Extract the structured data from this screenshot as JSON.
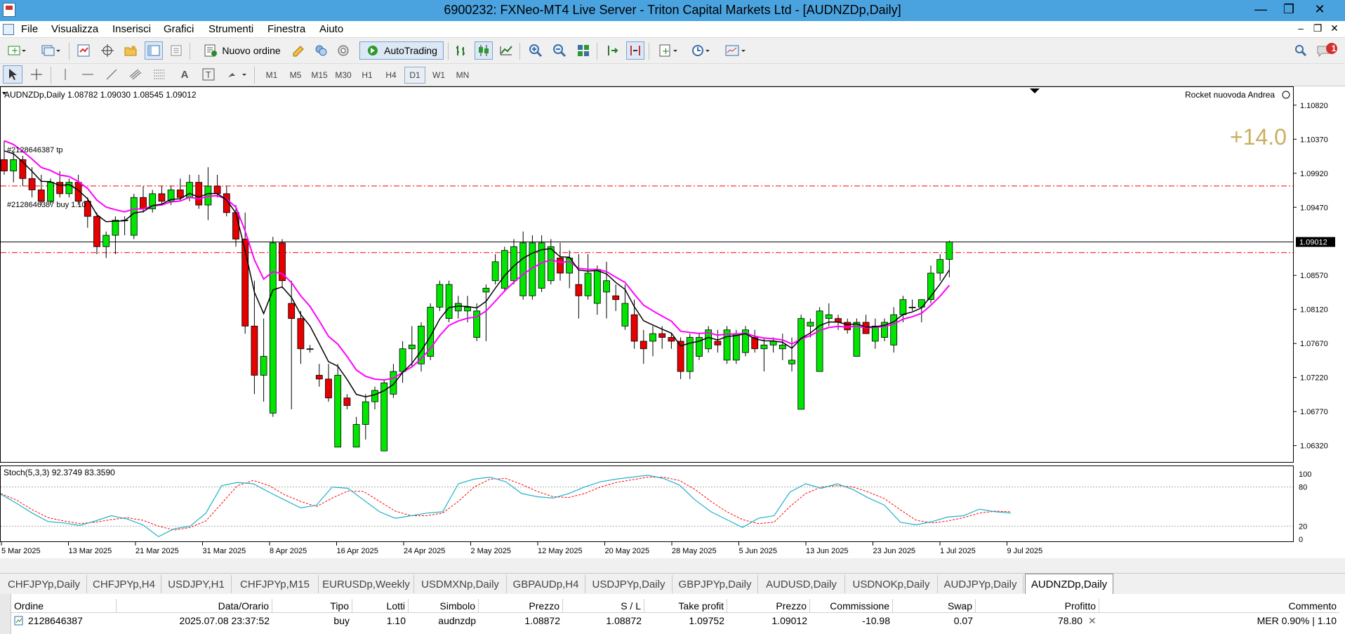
{
  "window": {
    "title": "6900232: FXNeo-MT4 Live Server - Triton Capital Markets Ltd - [AUDNZDp,Daily]"
  },
  "menu": {
    "items": [
      "File",
      "Visualizza",
      "Inserisci",
      "Grafici",
      "Strumenti",
      "Finestra",
      "Aiuto"
    ]
  },
  "toolbar": {
    "new_order_label": "Nuovo ordine",
    "autotrading_label": "AutoTrading",
    "notification_count": "1"
  },
  "timeframes": [
    "M1",
    "M5",
    "M15",
    "M30",
    "H1",
    "H4",
    "D1",
    "W1",
    "MN"
  ],
  "active_timeframe": "D1",
  "chart": {
    "header": "AUDNZDp,Daily  1.08782 1.09030 1.08545 1.09012",
    "expert_label": "Rocket nuovoda Andrea",
    "profit_big": "+14.0",
    "tp_label": "#2128646387 tp",
    "buy_label": "#2128646387 buy 1.10",
    "current_price": "1.09012",
    "stoch_label": "Stoch(5,3,3) 92.3749 83.3590",
    "colors": {
      "bull": "#00e600",
      "bear": "#e60000",
      "ma_fast": "#000000",
      "ma_slow": "#ff00ff",
      "stoch_main": "#20b2c8",
      "stoch_signal": "#ff0000",
      "profit": "#c8b060"
    }
  },
  "chart_data": {
    "type": "candlestick",
    "symbol": "AUDNZDp",
    "timeframe": "Daily",
    "y_ticks": [
      "1.10820",
      "1.10370",
      "1.09920",
      "1.09470",
      "1.09012",
      "1.08570",
      "1.08120",
      "1.07670",
      "1.07220",
      "1.06770",
      "1.06320"
    ],
    "x_labels": [
      "5 Mar 2025",
      "13 Mar 2025",
      "21 Mar 2025",
      "31 Mar 2025",
      "8 Apr 2025",
      "16 Apr 2025",
      "24 Apr 2025",
      "2 May 2025",
      "12 May 2025",
      "20 May 2025",
      "28 May 2025",
      "5 Jun 2025",
      "13 Jun 2025",
      "23 Jun 2025",
      "1 Jul 2025",
      "9 Jul 2025"
    ],
    "ylim": [
      1.0615,
      1.1105
    ],
    "tp_price": 1.09752,
    "entry_price": 1.08872,
    "candles": [
      [
        1.101,
        1.1035,
        1.099,
        1.0995
      ],
      [
        1.0995,
        1.102,
        1.098,
        1.101
      ],
      [
        1.101,
        1.1015,
        1.0975,
        1.0985
      ],
      [
        1.0985,
        1.1,
        1.096,
        1.097
      ],
      [
        1.097,
        1.099,
        1.095,
        1.0955
      ],
      [
        1.0955,
        1.0985,
        1.095,
        1.098
      ],
      [
        1.098,
        1.0995,
        1.096,
        1.0965
      ],
      [
        1.0965,
        1.0985,
        1.096,
        1.098
      ],
      [
        1.098,
        1.099,
        1.095,
        1.0955
      ],
      [
        1.0955,
        1.096,
        1.092,
        1.0935
      ],
      [
        1.0935,
        1.094,
        1.0885,
        1.0895
      ],
      [
        1.0895,
        1.0915,
        1.088,
        1.091
      ],
      [
        1.091,
        1.0935,
        1.0885,
        1.093
      ],
      [
        1.093,
        1.0935,
        1.091,
        1.093
      ],
      [
        1.091,
        1.0965,
        1.0905,
        1.096
      ],
      [
        1.096,
        1.0975,
        1.094,
        1.0945
      ],
      [
        1.0945,
        1.097,
        1.094,
        1.0965
      ],
      [
        1.0965,
        1.0975,
        1.095,
        1.0955
      ],
      [
        1.0955,
        1.0975,
        1.095,
        1.097
      ],
      [
        1.097,
        1.0985,
        1.0955,
        1.096
      ],
      [
        1.096,
        1.099,
        1.0955,
        1.098
      ],
      [
        1.098,
        1.099,
        1.0945,
        1.095
      ],
      [
        1.095,
        1.1,
        1.093,
        1.0975
      ],
      [
        1.0975,
        1.099,
        1.096,
        1.0965
      ],
      [
        1.0965,
        1.0975,
        1.0935,
        1.094
      ],
      [
        1.094,
        1.095,
        1.0895,
        1.0905
      ],
      [
        1.0905,
        1.094,
        1.078,
        1.079
      ],
      [
        1.079,
        1.085,
        1.07,
        1.0725
      ],
      [
        1.0725,
        1.08,
        1.069,
        1.075
      ],
      [
        1.0675,
        1.0908,
        1.067,
        1.09
      ],
      [
        1.09,
        1.0905,
        1.084,
        1.085
      ],
      [
        1.082,
        1.085,
        1.068,
        1.08
      ],
      [
        1.08,
        1.081,
        1.074,
        1.076
      ],
      [
        1.076,
        1.0765,
        1.0755,
        1.076
      ],
      [
        1.0725,
        1.074,
        1.071,
        1.072
      ],
      [
        1.072,
        1.074,
        1.069,
        1.0695
      ],
      [
        1.063,
        1.074,
        1.063,
        1.0725
      ],
      [
        1.0695,
        1.07,
        1.068,
        1.0685
      ],
      [
        1.063,
        1.067,
        1.063,
        1.066
      ],
      [
        1.066,
        1.07,
        1.064,
        1.069
      ],
      [
        1.069,
        1.071,
        1.068,
        1.0705
      ],
      [
        1.0625,
        1.072,
        1.0625,
        1.0715
      ],
      [
        1.07,
        1.074,
        1.0695,
        1.073
      ],
      [
        1.073,
        1.077,
        1.0715,
        1.076
      ],
      [
        1.076,
        1.079,
        1.0735,
        1.0765
      ],
      [
        1.074,
        1.0795,
        1.073,
        1.079
      ],
      [
        1.075,
        1.082,
        1.0745,
        1.0815
      ],
      [
        1.0815,
        1.085,
        1.081,
        1.0845
      ],
      [
        1.08,
        1.085,
        1.0795,
        1.0845
      ],
      [
        1.081,
        1.083,
        1.08,
        1.082
      ],
      [
        1.081,
        1.083,
        1.0795,
        1.0815
      ],
      [
        1.0775,
        1.082,
        1.077,
        1.081
      ],
      [
        1.0835,
        1.0845,
        1.077,
        1.084
      ],
      [
        1.085,
        1.0885,
        1.0845,
        1.0875
      ],
      [
        1.084,
        1.0895,
        1.0835,
        1.089
      ],
      [
        1.085,
        1.0905,
        1.0845,
        1.0895
      ],
      [
        1.083,
        1.0915,
        1.0825,
        1.09
      ],
      [
        1.083,
        1.091,
        1.0825,
        1.09
      ],
      [
        1.084,
        1.091,
        1.0835,
        1.09
      ],
      [
        1.085,
        1.0905,
        1.0845,
        1.0895
      ],
      [
        1.088,
        1.09,
        1.085,
        1.086
      ],
      [
        1.086,
        1.089,
        1.084,
        1.088
      ],
      [
        1.0845,
        1.0885,
        1.08,
        1.083
      ],
      [
        1.083,
        1.0885,
        1.0825,
        1.086
      ],
      [
        1.082,
        1.087,
        1.0805,
        1.0865
      ],
      [
        1.0835,
        1.0875,
        1.08,
        1.085
      ],
      [
        1.083,
        1.0845,
        1.081,
        1.0825
      ],
      [
        1.079,
        1.0845,
        1.0785,
        1.082
      ],
      [
        1.0805,
        1.0825,
        1.076,
        1.077
      ],
      [
        1.077,
        1.0785,
        1.074,
        1.076
      ],
      [
        1.077,
        1.079,
        1.075,
        1.078
      ],
      [
        1.078,
        1.079,
        1.076,
        1.0775
      ],
      [
        1.0775,
        1.078,
        1.076,
        1.077
      ],
      [
        1.077,
        1.0775,
        1.072,
        1.073
      ],
      [
        1.073,
        1.078,
        1.072,
        1.0775
      ],
      [
        1.075,
        1.078,
        1.0745,
        1.0775
      ],
      [
        1.076,
        1.079,
        1.0755,
        1.0785
      ],
      [
        1.077,
        1.0785,
        1.0755,
        1.0765
      ],
      [
        1.0745,
        1.079,
        1.074,
        1.0785
      ],
      [
        1.0745,
        1.0785,
        1.074,
        1.078
      ],
      [
        1.0755,
        1.079,
        1.075,
        1.0785
      ],
      [
        1.0775,
        1.0785,
        1.0755,
        1.076
      ],
      [
        1.076,
        1.0775,
        1.073,
        1.0765
      ],
      [
        1.0765,
        1.0775,
        1.0755,
        1.077
      ],
      [
        1.076,
        1.078,
        1.0745,
        1.0765
      ],
      [
        1.074,
        1.0775,
        1.073,
        1.0745
      ],
      [
        1.068,
        1.0805,
        1.068,
        1.08
      ],
      [
        1.079,
        1.08,
        1.0775,
        1.0795
      ],
      [
        1.073,
        1.0815,
        1.073,
        1.081
      ],
      [
        1.08,
        1.082,
        1.079,
        1.0805
      ],
      [
        1.08,
        1.0805,
        1.0785,
        1.0795
      ],
      [
        1.0795,
        1.08,
        1.078,
        1.0785
      ],
      [
        1.075,
        1.08,
        1.075,
        1.0795
      ],
      [
        1.0795,
        1.0805,
        1.078,
        1.078
      ],
      [
        1.077,
        1.08,
        1.076,
        1.079
      ],
      [
        1.0775,
        1.08,
        1.077,
        1.0795
      ],
      [
        1.0765,
        1.0815,
        1.0755,
        1.0805
      ],
      [
        1.0805,
        1.083,
        1.0795,
        1.0825
      ],
      [
        1.0815,
        1.0825,
        1.081,
        1.0815
      ],
      [
        1.0815,
        1.0825,
        1.0795,
        1.0825
      ],
      [
        1.0825,
        1.087,
        1.082,
        1.086
      ],
      [
        1.086,
        1.0885,
        1.085,
        1.0878
      ],
      [
        1.08782,
        1.0903,
        1.08545,
        1.09012
      ]
    ],
    "stochastic": {
      "main": [
        69,
        55,
        40,
        27,
        25,
        21,
        28,
        36,
        31,
        22,
        4,
        16,
        20,
        40,
        82,
        87,
        85,
        72,
        60,
        48,
        52,
        80,
        78,
        60,
        42,
        32,
        36,
        40,
        42,
        85,
        92,
        95,
        88,
        70,
        65,
        63,
        70,
        80,
        88,
        92,
        95,
        98,
        93,
        83,
        60,
        42,
        30,
        18,
        32,
        36,
        72,
        85,
        78,
        85,
        76,
        63,
        52,
        26,
        22,
        27,
        34,
        36,
        46,
        42,
        40
      ],
      "signal": [
        70,
        60,
        45,
        33,
        28,
        24,
        26,
        30,
        33,
        29,
        20,
        14,
        18,
        28,
        55,
        82,
        90,
        82,
        68,
        58,
        50,
        63,
        74,
        73,
        58,
        43,
        36,
        36,
        40,
        58,
        80,
        92,
        93,
        84,
        73,
        65,
        64,
        70,
        80,
        87,
        91,
        95,
        95,
        90,
        76,
        58,
        42,
        30,
        24,
        26,
        50,
        70,
        80,
        82,
        80,
        72,
        62,
        45,
        29,
        25,
        28,
        33,
        40,
        43,
        42
      ]
    },
    "indicator": {
      "name": "Stoch(5,3,3)",
      "main": 92.3749,
      "signal": 83.359,
      "levels": [
        "100",
        "80",
        "20",
        "0"
      ]
    }
  },
  "tabs": [
    "CHFJPYp,Daily",
    "CHFJPYp,H4",
    "USDJPY,H1",
    "CHFJPYp,M15",
    "EURUSDp,Weekly",
    "USDMXNp,Daily",
    "GBPAUDp,H4",
    "USDJPYp,Daily",
    "GBPJPYp,Daily",
    "AUDUSD,Daily",
    "USDNOKp,Daily",
    "AUDJPYp,Daily",
    "AUDNZDp,Daily"
  ],
  "active_tab": "AUDNZDp,Daily",
  "terminal": {
    "headers": [
      "Ordine",
      "Data/Orario",
      "Tipo",
      "Lotti",
      "Simbolo",
      "Prezzo",
      "S / L",
      "Take profit",
      "Prezzo",
      "Commissione",
      "Swap",
      "Profitto",
      "Commento"
    ],
    "rows": [
      [
        "2128646387",
        "2025.07.08 23:37:52",
        "buy",
        "1.10",
        "audnzdp",
        "1.08872",
        "1.08872",
        "1.09752",
        "1.09012",
        "-10.98",
        "0.07",
        "78.80",
        "MER 0.90% | 1.10"
      ]
    ]
  }
}
